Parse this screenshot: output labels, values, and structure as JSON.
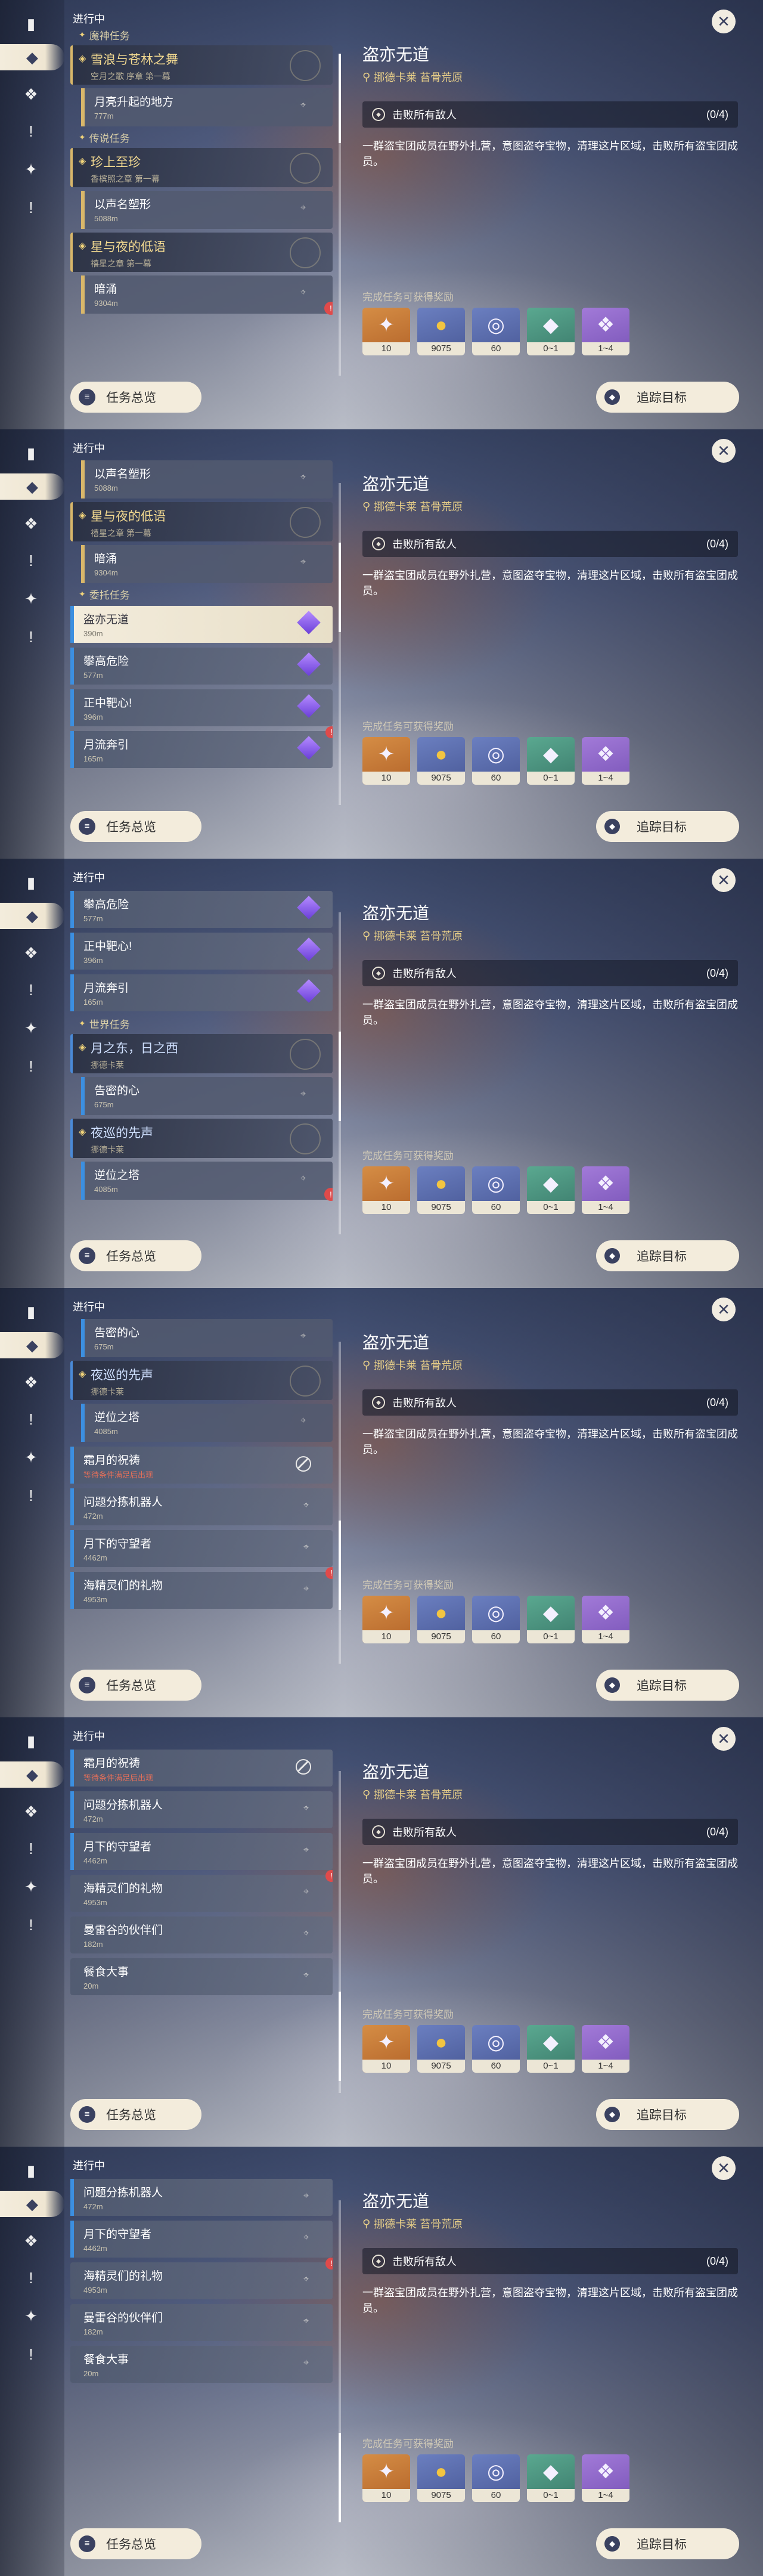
{
  "app": {
    "status": "进行中",
    "overview_label": "任务总览",
    "track_label": "追踪目标",
    "close_glyph": "✕"
  },
  "detail": {
    "title": "盗亦无道",
    "location": "挪德卡莱 苔骨荒原",
    "objective": "击败所有敌人",
    "progress": "(0/4)",
    "description": "一群盗宝团成员在野外扎营，意图盗夺宝物，清理这片区域，击败所有盗宝团成员。",
    "reward_label": "完成任务可获得奖励",
    "rewards": [
      {
        "icon": "star-crystal-icon",
        "count": "10",
        "color": "#c27a38"
      },
      {
        "icon": "mora-coin-icon",
        "count": "9075",
        "color": "#5c6ea8"
      },
      {
        "icon": "exp-icon",
        "count": "60",
        "color": "#5c6ea8"
      },
      {
        "icon": "material-icon",
        "count": "0~1",
        "color": "#4a907c"
      },
      {
        "icon": "ore-icon",
        "count": "1~4",
        "color": "#8e68c8"
      }
    ]
  },
  "frames": [
    {
      "scroll": "0",
      "items": [
        {
          "kind": "section",
          "label": "魔神任务",
          "icon": "archon-icon"
        },
        {
          "kind": "main",
          "label": "雪浪与苍林之舞",
          "sub": "空月之歌 序章 第一幕"
        },
        {
          "kind": "sub",
          "label": "月亮升起的地方",
          "dist": "777m",
          "tone": "gold"
        },
        {
          "kind": "section",
          "label": "传说任务",
          "icon": "legend-icon"
        },
        {
          "kind": "main",
          "label": "珍上至珍",
          "sub": "香槟照之章 第一幕"
        },
        {
          "kind": "sub",
          "label": "以声名塑形",
          "dist": "5088m",
          "tone": "gold"
        },
        {
          "kind": "main",
          "label": "星与夜的低语",
          "sub": "禧星之章 第一幕"
        },
        {
          "kind": "sub",
          "label": "暗涌",
          "dist": "9304m",
          "tone": "gold",
          "alert": "!"
        }
      ]
    },
    {
      "scroll": "1",
      "items": [
        {
          "kind": "sub",
          "label": "以声名塑形",
          "dist": "5088m",
          "tone": "gold"
        },
        {
          "kind": "main",
          "label": "星与夜的低语",
          "sub": "禧星之章 第一幕"
        },
        {
          "kind": "sub",
          "label": "暗涌",
          "dist": "9304m",
          "tone": "gold"
        },
        {
          "kind": "section",
          "label": "委托任务",
          "icon": "commission-icon"
        },
        {
          "kind": "row",
          "label": "盗亦无道",
          "dist": "390m",
          "selected": true,
          "badge": "star"
        },
        {
          "kind": "row",
          "label": "攀高危险",
          "dist": "577m",
          "badge": "star"
        },
        {
          "kind": "row",
          "label": "正中靶心!",
          "dist": "396m",
          "badge": "star"
        },
        {
          "kind": "row",
          "label": "月流奔引",
          "dist": "165m",
          "badge": "star",
          "alert": "!"
        }
      ]
    },
    {
      "scroll": "2",
      "items": [
        {
          "kind": "row",
          "label": "攀高危险",
          "dist": "577m",
          "badge": "star"
        },
        {
          "kind": "row",
          "label": "正中靶心!",
          "dist": "396m",
          "badge": "star"
        },
        {
          "kind": "row",
          "label": "月流奔引",
          "dist": "165m",
          "badge": "star"
        },
        {
          "kind": "section",
          "label": "世界任务",
          "icon": "world-icon"
        },
        {
          "kind": "main",
          "label": "月之东，日之西",
          "sub": "挪德卡莱",
          "blue": true
        },
        {
          "kind": "sub",
          "label": "告密的心",
          "dist": "675m",
          "tone": "blue"
        },
        {
          "kind": "main",
          "label": "夜巡的先声",
          "sub": "挪德卡莱",
          "blue": true
        },
        {
          "kind": "sub",
          "label": "逆位之塔",
          "dist": "4085m",
          "tone": "blue",
          "alert": "!"
        }
      ]
    },
    {
      "scroll": "3",
      "items": [
        {
          "kind": "sub",
          "label": "告密的心",
          "dist": "675m",
          "tone": "blue"
        },
        {
          "kind": "main",
          "label": "夜巡的先声",
          "sub": "挪德卡莱",
          "blue": true
        },
        {
          "kind": "sub",
          "label": "逆位之塔",
          "dist": "4085m",
          "tone": "blue"
        },
        {
          "kind": "row",
          "label": "霜月的祝祷",
          "hint": "等待条件满足后出现",
          "badge": "block"
        },
        {
          "kind": "row",
          "label": "问题分拣机器人",
          "dist": "472m",
          "badge": "pin"
        },
        {
          "kind": "row",
          "label": "月下的守望者",
          "dist": "4462m",
          "badge": "pin"
        },
        {
          "kind": "row",
          "label": "海精灵们的礼物",
          "dist": "4953m",
          "badge": "pin",
          "alert": "!"
        }
      ]
    },
    {
      "scroll": "4",
      "items": [
        {
          "kind": "row",
          "label": "霜月的祝祷",
          "hint": "等待条件满足后出现",
          "badge": "block"
        },
        {
          "kind": "row",
          "label": "问题分拣机器人",
          "dist": "472m",
          "badge": "pin"
        },
        {
          "kind": "row",
          "label": "月下的守望者",
          "dist": "4462m",
          "badge": "pin"
        },
        {
          "kind": "row",
          "label": "海精灵们的礼物",
          "dist": "4953m",
          "badge": "pin",
          "alert": "!",
          "plain": true
        },
        {
          "kind": "row",
          "label": "曼雷谷的伙伴们",
          "dist": "182m",
          "badge": "pin",
          "plain": true
        },
        {
          "kind": "row",
          "label": "餐食大事",
          "dist": "20m",
          "badge": "pin",
          "plain": true
        }
      ]
    },
    {
      "scroll": "5",
      "items": [
        {
          "kind": "row",
          "label": "问题分拣机器人",
          "dist": "472m",
          "badge": "pin"
        },
        {
          "kind": "row",
          "label": "月下的守望者",
          "dist": "4462m",
          "badge": "pin"
        },
        {
          "kind": "row",
          "label": "海精灵们的礼物",
          "dist": "4953m",
          "badge": "pin",
          "alert": "!",
          "plain": true
        },
        {
          "kind": "row",
          "label": "曼雷谷的伙伴们",
          "dist": "182m",
          "badge": "pin",
          "plain": true
        },
        {
          "kind": "row",
          "label": "餐食大事",
          "dist": "20m",
          "badge": "pin",
          "plain": true
        }
      ]
    }
  ],
  "rail": [
    {
      "icon": "quest-book-icon",
      "glyph": "▮"
    },
    {
      "icon": "archon-quest-icon",
      "glyph": "◆"
    },
    {
      "icon": "story-quest-icon",
      "glyph": "❖"
    },
    {
      "icon": "commission-icon",
      "glyph": "!"
    },
    {
      "icon": "world-quest-icon",
      "glyph": "✦"
    },
    {
      "icon": "event-quest-icon",
      "glyph": "!"
    }
  ]
}
